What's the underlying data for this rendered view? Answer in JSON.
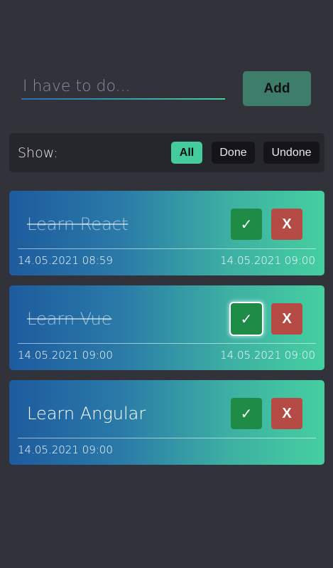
{
  "new_todo": {
    "placeholder": "I have to do...",
    "value": "",
    "add_label": "Add"
  },
  "filter": {
    "label": "Show:",
    "options": [
      "All",
      "Done",
      "Undone"
    ],
    "selected": "All"
  },
  "todos": [
    {
      "title": "Learn React",
      "done": true,
      "created": "14.05.2021 08:59",
      "completed": "14.05.2021 09:00",
      "check_icon": "✓",
      "delete_icon": "X"
    },
    {
      "title": "Learn Vue",
      "done": true,
      "created": "14.05.2021 09:00",
      "completed": "14.05.2021 09:00",
      "check_icon": "✓",
      "delete_icon": "X"
    },
    {
      "title": "Learn Angular",
      "done": false,
      "created": "14.05.2021 09:00",
      "completed": "",
      "check_icon": "✓",
      "delete_icon": "X"
    }
  ],
  "colors": {
    "background": "#32323b",
    "accent": "#45cc9d",
    "check": "#1e8b46",
    "delete": "#b64a44",
    "card_gradient_start": "#1d5b9e",
    "card_gradient_end": "#45cfa0"
  }
}
